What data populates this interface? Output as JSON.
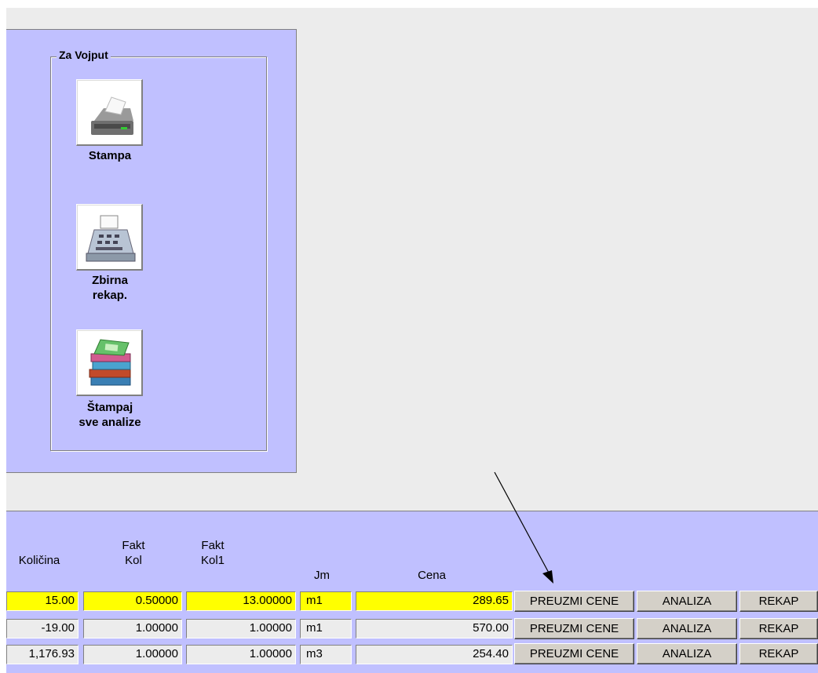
{
  "groupbox": {
    "title": "Za Vojput"
  },
  "tools": [
    {
      "label_l1": "Stampa",
      "label_l2": "",
      "icon": "printer-icon"
    },
    {
      "label_l1": "Zbirna",
      "label_l2": "rekap.",
      "icon": "cash-register-icon"
    },
    {
      "label_l1": "Štampaj",
      "label_l2": "sve analize",
      "icon": "books-icon"
    }
  ],
  "grid": {
    "headers": {
      "kolicina": "Količina",
      "fakt_kol_l1": "Fakt",
      "fakt_kol_l2": "Kol",
      "fakt_kol1_l1": "Fakt",
      "fakt_kol1_l2": "Kol1",
      "jm": "Jm",
      "cena": "Cena"
    },
    "rows": [
      {
        "kolicina": "15.00",
        "fakt_kol": "0.50000",
        "fakt_kol1": "13.00000",
        "jm": "m1",
        "cena": "289.65",
        "highlighted": true
      },
      {
        "kolicina": "-19.00",
        "fakt_kol": "1.00000",
        "fakt_kol1": "1.00000",
        "jm": "m1",
        "cena": "570.00",
        "highlighted": false
      },
      {
        "kolicina": "1,176.93",
        "fakt_kol": "1.00000",
        "fakt_kol1": "1.00000",
        "jm": "m3",
        "cena": "254.40",
        "highlighted": false
      }
    ],
    "row_buttons": {
      "preuzmi": "PREUZMI CENE",
      "analiza": "ANALIZA",
      "rekap": "REKAP"
    }
  },
  "colors": {
    "panel": "#c0c0ff",
    "highlight_row": "#ffff00",
    "app_bg": "#ececec"
  }
}
